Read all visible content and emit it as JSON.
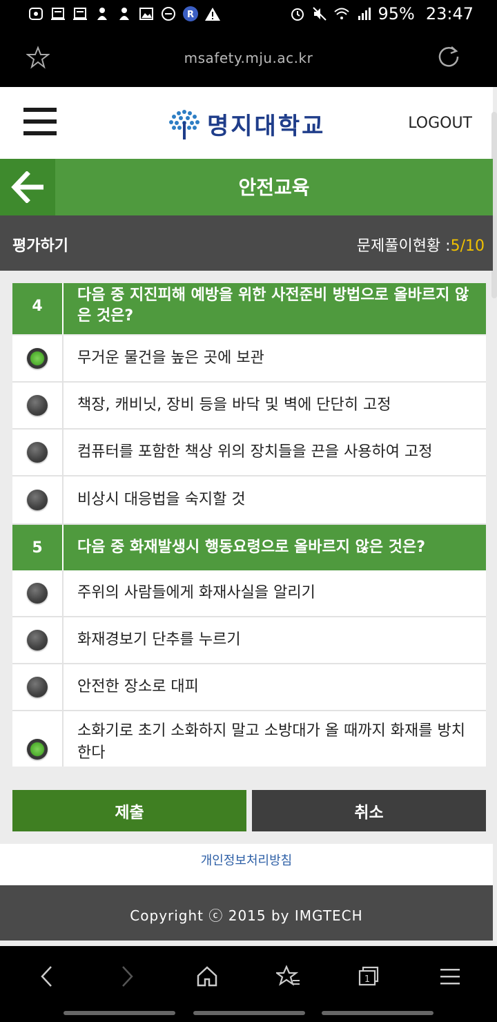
{
  "status": {
    "battery": "95%",
    "time": "23:47"
  },
  "browser": {
    "url": "msafety.mju.ac.kr"
  },
  "header": {
    "logo_text": "명지대학교",
    "logout": "LOGOUT"
  },
  "titlebar": {
    "title": "안전교육"
  },
  "subbar": {
    "label": "평가하기",
    "progress_label": "문제풀이현황 :",
    "progress_value": "5/10"
  },
  "questions": [
    {
      "number": "4",
      "text": "다음 중 지진피해 예방을 위한 사전준비 방법으로 올바르지 않은 것은?",
      "options": [
        {
          "text": "무거운 물건을 높은 곳에 보관",
          "selected": true
        },
        {
          "text": "책장, 캐비닛, 장비 등을 바닥 및 벽에 단단히 고정",
          "selected": false
        },
        {
          "text": "컴퓨터를 포함한 책상 위의 장치들을 끈을 사용하여 고정",
          "selected": false
        },
        {
          "text": "비상시 대응법을 숙지할 것",
          "selected": false
        }
      ]
    },
    {
      "number": "5",
      "text": "다음 중 화재발생시 행동요령으로 올바르지 않은 것은?",
      "options": [
        {
          "text": "주위의 사람들에게 화재사실을 알리기",
          "selected": false
        },
        {
          "text": "화재경보기 단추를 누르기",
          "selected": false
        },
        {
          "text": "안전한 장소로 대피",
          "selected": false
        },
        {
          "text": "소화기로 초기 소화하지 말고 소방대가 올 때까지 화재를 방치한다",
          "selected": true
        }
      ]
    }
  ],
  "buttons": {
    "submit": "제출",
    "cancel": "취소"
  },
  "footer": {
    "privacy": "개인정보처리방침",
    "copyright": "Copyright ⓒ 2015 by IMGTECH"
  },
  "colors": {
    "green": "#4f9a3e",
    "dark_green": "#3f7f22",
    "gray_bar": "#4a4a4a",
    "progress_yellow": "#f0c000"
  }
}
